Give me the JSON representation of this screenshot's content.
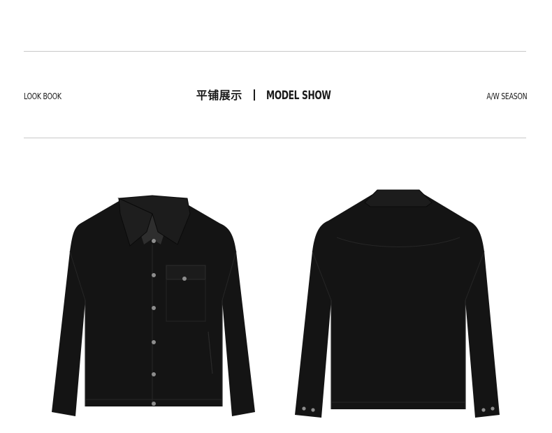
{
  "header": {
    "left_label": "LOOK BOOK",
    "center_cn": "平铺展示",
    "center_en": "MODEL SHOW",
    "right_label": "A/W SEASON"
  },
  "images": {
    "front": "jacket-front-image",
    "back": "jacket-back-image"
  },
  "colors": {
    "rule": "#c8c8c8",
    "garment": "#141414",
    "text": "#1a1a1a"
  }
}
